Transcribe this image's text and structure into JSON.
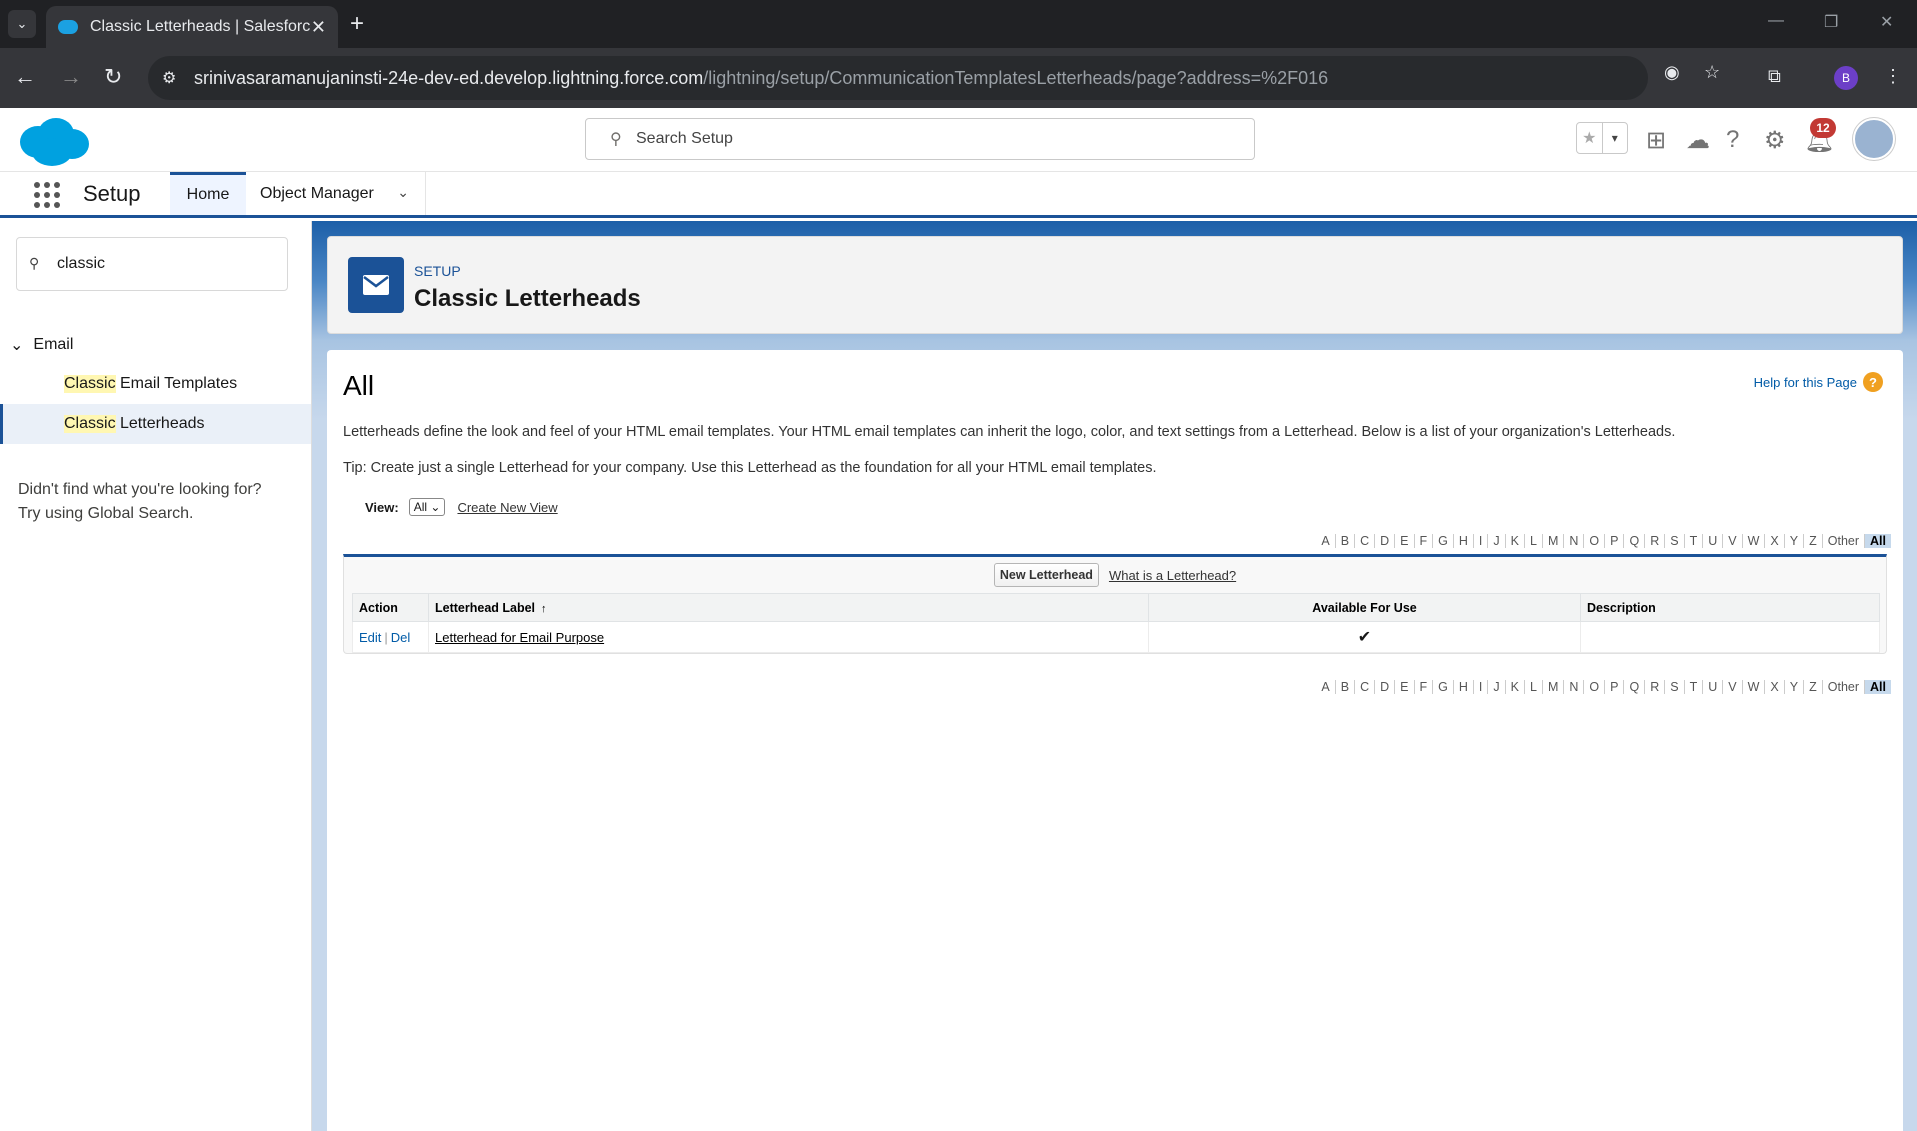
{
  "browser": {
    "tab_title": "Classic Letterheads | Salesforce",
    "url_host": "srinivasaramanujaninsti-24e-dev-ed.develop.lightning.force.com",
    "url_path": "/lightning/setup/CommunicationTemplatesLetterheads/page?address=%2F016",
    "profile_initial": "B"
  },
  "header": {
    "search_placeholder": "Search Setup",
    "notification_count": "12"
  },
  "setup_nav": {
    "app_name": "Setup",
    "home": "Home",
    "object_manager": "Object Manager"
  },
  "sidebar": {
    "quick_find_value": "classic",
    "section": "Email",
    "items": [
      {
        "highlight": "Classic",
        "rest": " Email Templates"
      },
      {
        "highlight": "Classic",
        "rest": " Letterheads"
      }
    ],
    "not_found_1": "Didn't find what you're looking for?",
    "not_found_2": "Try using Global Search."
  },
  "page_header": {
    "breadcrumb": "SETUP",
    "title": "Classic Letterheads"
  },
  "content": {
    "heading": "All",
    "help_link": "Help for this Page",
    "description": "Letterheads define the look and feel of your HTML email templates. Your HTML email templates can inherit the logo, color, and text settings from a Letterhead. Below is a list of your organization's Letterheads.",
    "tip": "Tip: Create just a single Letterhead for your company. Use this Letterhead as the foundation for all your HTML email templates.",
    "view_label": "View:",
    "view_selected": "All",
    "create_view": "Create New View",
    "alpha": [
      "A",
      "B",
      "C",
      "D",
      "E",
      "F",
      "G",
      "H",
      "I",
      "J",
      "K",
      "L",
      "M",
      "N",
      "O",
      "P",
      "Q",
      "R",
      "S",
      "T",
      "U",
      "V",
      "W",
      "X",
      "Y",
      "Z",
      "Other",
      "All"
    ],
    "new_button": "New Letterhead",
    "what_is": "What is a Letterhead?",
    "columns": {
      "action": "Action",
      "label": "Letterhead Label",
      "available": "Available For Use",
      "description": "Description"
    },
    "rows": [
      {
        "edit": "Edit",
        "del": "Del",
        "label": "Letterhead for Email Purpose",
        "available": "✔",
        "description": ""
      }
    ]
  }
}
